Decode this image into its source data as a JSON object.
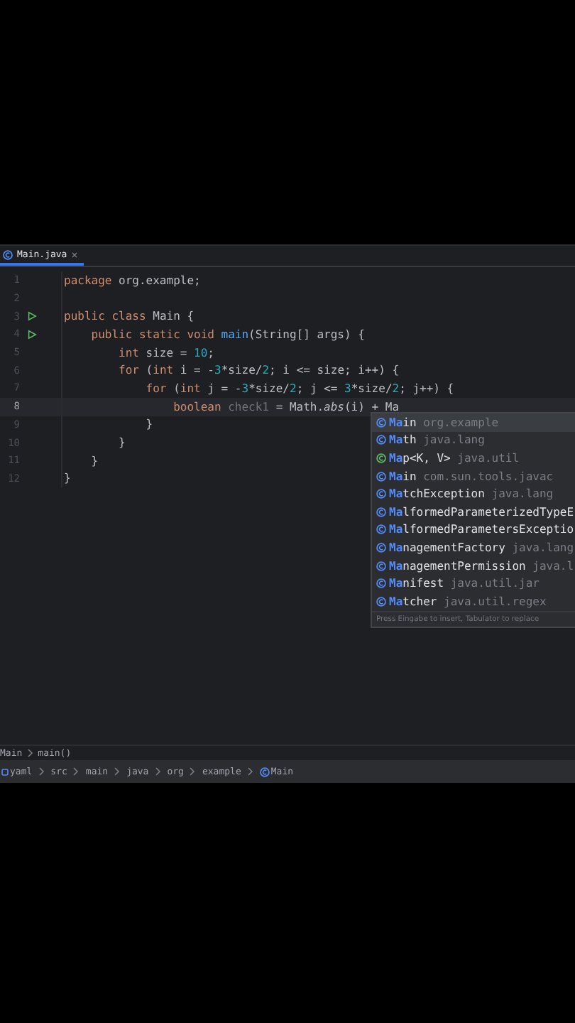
{
  "tabs": [
    {
      "label": "Main.java",
      "selected": true
    }
  ],
  "lines": [
    {
      "number": "1",
      "run": false,
      "current": false,
      "tokens": [
        {
          "text": "package ",
          "kind": "keyword"
        },
        {
          "text": "org.example;",
          "kind": "plain"
        }
      ]
    },
    {
      "number": "2",
      "run": false,
      "current": false
    },
    {
      "number": "3",
      "run": true,
      "current": false,
      "tokens": [
        {
          "text": "public class ",
          "kind": "keyword"
        },
        {
          "text": "Main {",
          "kind": "plain"
        }
      ]
    },
    {
      "number": "4",
      "run": true,
      "current": false,
      "tokens": [
        {
          "text": "    public static void ",
          "kind": "keyword"
        },
        {
          "text": "main",
          "kind": "method"
        },
        {
          "text": "(String[] args) {",
          "kind": "plain"
        }
      ]
    },
    {
      "number": "5",
      "run": false,
      "current": false,
      "tokens": [
        {
          "text": "        int ",
          "kind": "keyword"
        },
        {
          "text": "size = ",
          "kind": "plain"
        },
        {
          "text": "10",
          "kind": "number"
        },
        {
          "text": ";",
          "kind": "plain"
        }
      ]
    },
    {
      "number": "6",
      "run": false,
      "current": false,
      "tokens": [
        {
          "text": "        for ",
          "kind": "keyword"
        },
        {
          "text": "(",
          "kind": "plain"
        },
        {
          "text": "int ",
          "kind": "keyword"
        },
        {
          "text": "i = -",
          "kind": "plain"
        },
        {
          "text": "3",
          "kind": "number"
        },
        {
          "text": "*size/",
          "kind": "plain"
        },
        {
          "text": "2",
          "kind": "number"
        },
        {
          "text": "; i <= size; i++) {",
          "kind": "plain"
        }
      ]
    },
    {
      "number": "7",
      "run": false,
      "current": false,
      "tokens": [
        {
          "text": "            for ",
          "kind": "keyword"
        },
        {
          "text": "(",
          "kind": "plain"
        },
        {
          "text": "int ",
          "kind": "keyword"
        },
        {
          "text": "j = -",
          "kind": "plain"
        },
        {
          "text": "3",
          "kind": "number"
        },
        {
          "text": "*size/",
          "kind": "plain"
        },
        {
          "text": "2",
          "kind": "number"
        },
        {
          "text": "; j <= ",
          "kind": "plain"
        },
        {
          "text": "3",
          "kind": "number"
        },
        {
          "text": "*size/",
          "kind": "plain"
        },
        {
          "text": "2",
          "kind": "number"
        },
        {
          "text": "; j++) {",
          "kind": "plain"
        }
      ]
    },
    {
      "number": "8",
      "run": false,
      "current": true,
      "tokens": [
        {
          "text": "                boolean ",
          "kind": "keyword"
        },
        {
          "text": "check1",
          "kind": "unused"
        },
        {
          "text": " = Math.",
          "kind": "plain"
        },
        {
          "text": "abs",
          "kind": "italic"
        },
        {
          "text": "(i) + Ma",
          "kind": "plain"
        }
      ]
    },
    {
      "number": "9",
      "run": false,
      "current": false,
      "tokens": [
        {
          "text": "            }",
          "kind": "plain"
        }
      ]
    },
    {
      "number": "10",
      "run": false,
      "current": false,
      "tokens": [
        {
          "text": "        }",
          "kind": "plain"
        }
      ]
    },
    {
      "number": "11",
      "run": false,
      "current": false,
      "tokens": [
        {
          "text": "    }",
          "kind": "plain"
        }
      ]
    },
    {
      "number": "12",
      "run": false,
      "current": false,
      "tokens": [
        {
          "text": "}",
          "kind": "plain"
        }
      ]
    }
  ],
  "completion": {
    "items": [
      {
        "kind": "class",
        "name": "**Ma**in",
        "detail": "org.example",
        "selected": true
      },
      {
        "kind": "class",
        "name": "**Ma**th",
        "detail": "java.lang",
        "selected": false
      },
      {
        "kind": "interface",
        "name": "**Ma**p<K, V>",
        "detail": "java.util",
        "selected": false
      },
      {
        "kind": "class",
        "name": "**Ma**in",
        "detail": "com.sun.tools.javac",
        "selected": false
      },
      {
        "kind": "class",
        "name": "**Ma**tchException",
        "detail": "java.lang",
        "selected": false
      },
      {
        "kind": "class",
        "name": "**Ma**lformedParameterizedTypeE",
        "selected": false
      },
      {
        "kind": "class",
        "name": "**Ma**lformedParametersExceptio",
        "selected": false
      },
      {
        "kind": "class",
        "name": "**Ma**nagementFactory",
        "detail": "java.lang",
        "selected": false
      },
      {
        "kind": "class",
        "name": "**Ma**nagementPermission",
        "detail": "java.l",
        "selected": false
      },
      {
        "kind": "class",
        "name": "**Ma**nifest",
        "detail": "java.util.jar",
        "selected": false
      },
      {
        "kind": "class",
        "name": "**Ma**tcher",
        "detail": "java.util.regex",
        "selected": false
      }
    ],
    "hint": "Press Eingabe to insert, Tabulator to replace"
  },
  "breadcrumb": [
    "Main",
    "main()"
  ],
  "navigation": [
    {
      "label": "yaml",
      "kind": "module"
    },
    {
      "label": "src",
      "kind": "folder"
    },
    {
      "label": "main",
      "kind": "folder"
    },
    {
      "label": "java",
      "kind": "folder"
    },
    {
      "label": "org",
      "kind": "folder"
    },
    {
      "label": "example",
      "kind": "folder"
    },
    {
      "label": "Main",
      "kind": "class"
    }
  ]
}
